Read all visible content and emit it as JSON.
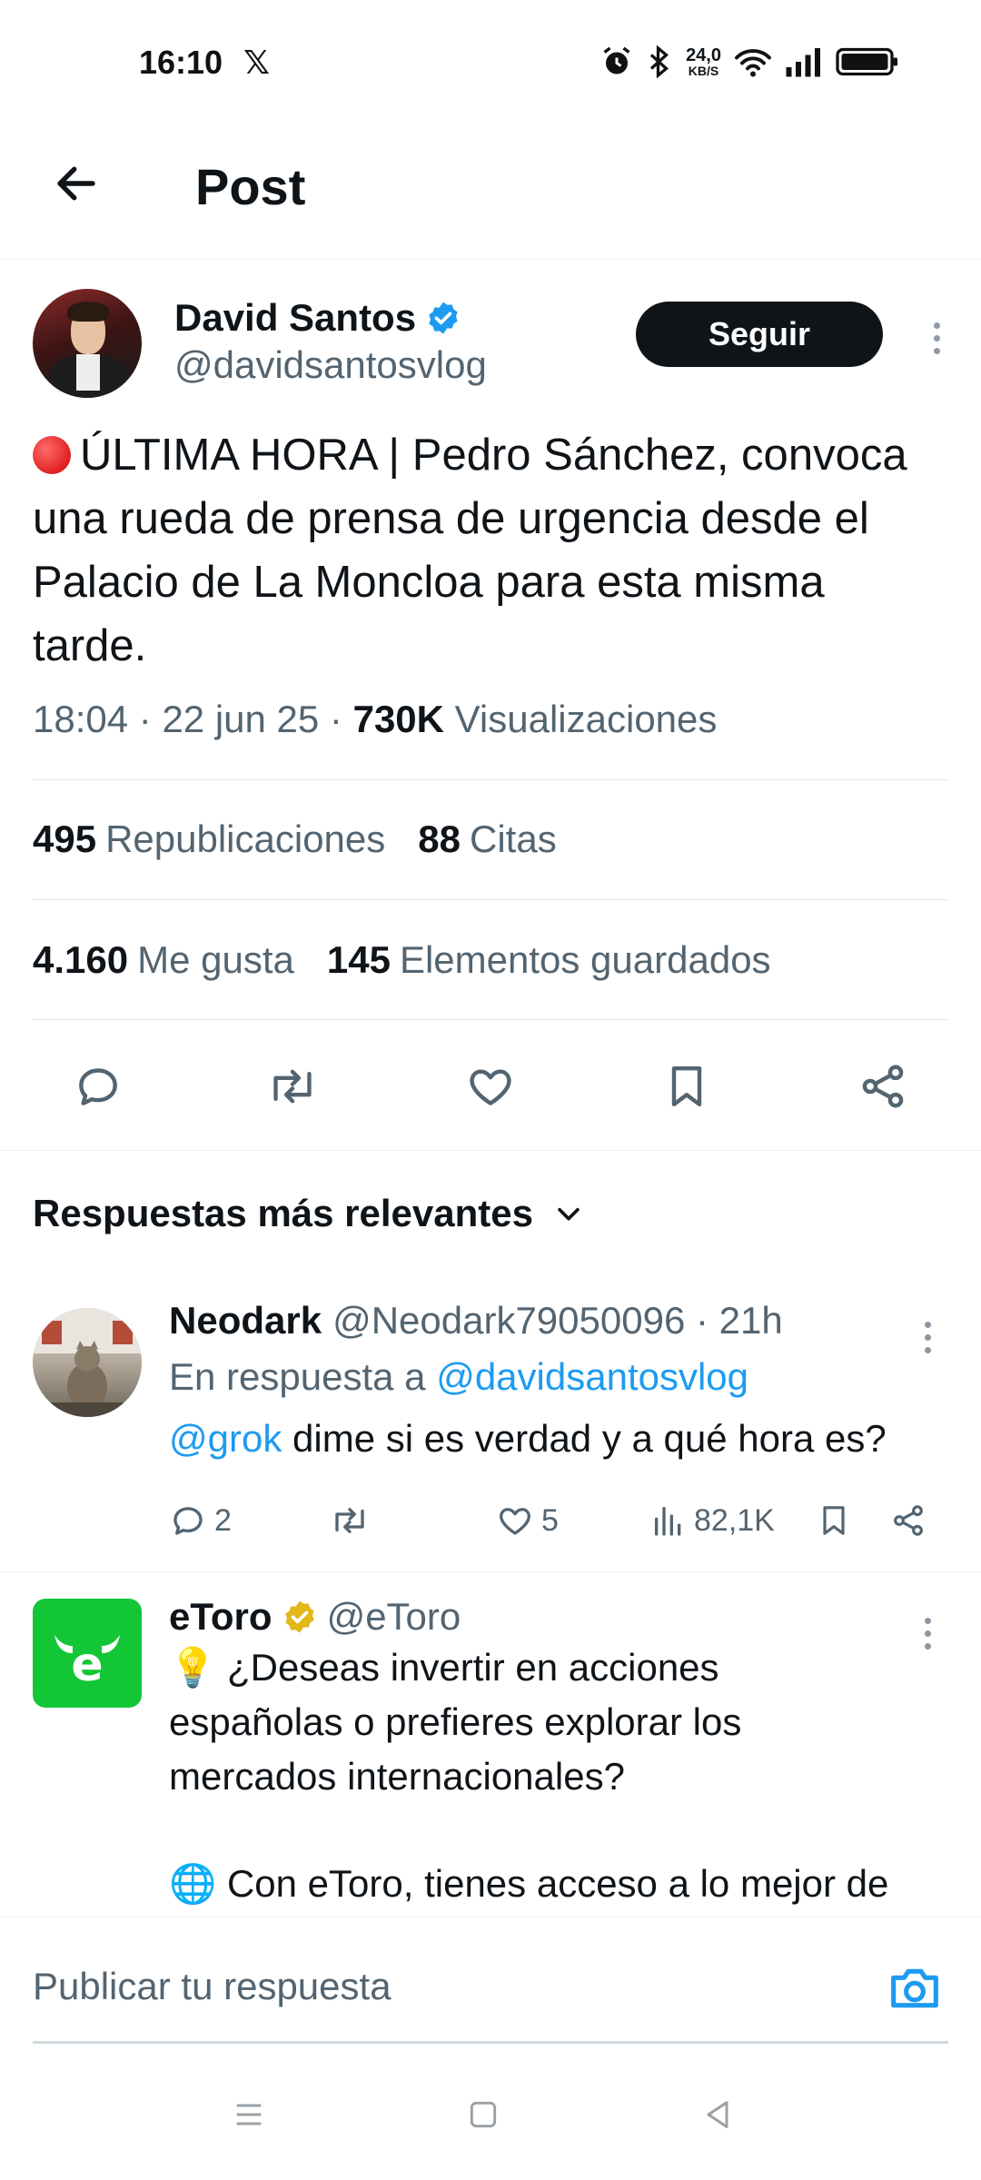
{
  "status": {
    "time": "16:10",
    "x_logo": "𝕏",
    "speed_value": "24,0",
    "speed_unit": "KB/S"
  },
  "header": {
    "title": "Post"
  },
  "post": {
    "author_name": "David Santos",
    "author_handle": "@davidsantosvlog",
    "follow_label": "Seguir",
    "text": "ÚLTIMA HORA | Pedro Sánchez, convoca una rueda de prensa de urgencia desde el Palacio de La Moncloa para esta misma tarde.",
    "time": "18:04",
    "date": "22 jun 25",
    "views_count": "730K",
    "views_label": "Visualizaciones",
    "reposts_count": "495",
    "reposts_label": "Republicaciones",
    "quotes_count": "88",
    "quotes_label": "Citas",
    "likes_count": "4.160",
    "likes_label": "Me gusta",
    "bookmarks_count": "145",
    "bookmarks_label": "Elementos guardados"
  },
  "replies_sort": {
    "label": "Respuestas más relevantes"
  },
  "replies": [
    {
      "name": "Neodark",
      "handle": "@Neodark79050096",
      "age": "21h",
      "in_reply_prefix": "En respuesta a",
      "in_reply_handle": "@davidsantosvlog",
      "mention": "@grok",
      "text": "dime si es verdad y a qué hora es?",
      "reply_count": "2",
      "like_count": "5",
      "views_count": "82,1K"
    }
  ],
  "ad": {
    "name": "eToro",
    "handle": "@eToro",
    "logo_letter": "e",
    "line1": "¿Deseas invertir en acciones",
    "line2": "españolas o prefieres explorar los",
    "line3": "mercados internacionales?",
    "line4": "Con eToro, tienes acceso a lo mejor de"
  },
  "composer": {
    "placeholder": "Publicar tu respuesta"
  },
  "colors": {
    "link": "#1d9bf0",
    "verified_blue": "#1d9bf0",
    "verified_gold": "#e2b719",
    "etoro_green": "#13c636",
    "text": "#0f1419",
    "muted": "#536471"
  }
}
